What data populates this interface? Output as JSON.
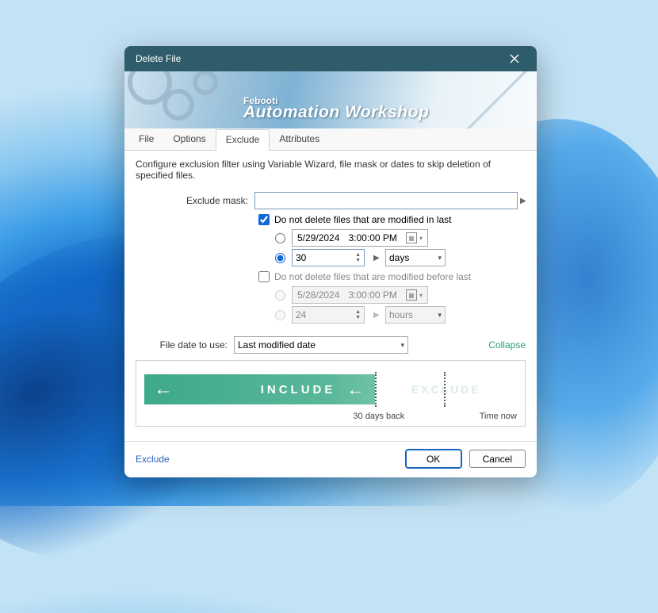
{
  "window": {
    "title": "Delete File"
  },
  "banner": {
    "small": "Febooti",
    "big": "Automation Workshop"
  },
  "tabs": [
    "File",
    "Options",
    "Exclude",
    "Attributes"
  ],
  "active_tab": 2,
  "description": "Configure exclusion filter using Variable Wizard, file mask or dates to skip deletion of specified files.",
  "exclude_mask": {
    "label": "Exclude mask:",
    "value": ""
  },
  "mod_in_last": {
    "checkbox_label": "Do not delete files that are modified in last",
    "checked": true,
    "date_option": {
      "selected": false,
      "date": "5/29/2024",
      "time": "3:00:00 PM"
    },
    "num_option": {
      "selected": true,
      "value": "30",
      "unit": "days"
    }
  },
  "mod_before_last": {
    "checkbox_label": "Do not delete files that are modified before last",
    "checked": false,
    "date_option": {
      "selected": false,
      "date": "5/28/2024",
      "time": "3:00:00 PM"
    },
    "num_option": {
      "selected": false,
      "value": "24",
      "unit": "hours"
    }
  },
  "file_date": {
    "label": "File date to use:",
    "value": "Last modified date"
  },
  "collapse_label": "Collapse",
  "timeline": {
    "include_label": "INCLUDE",
    "exclude_label": "EXCLUDE",
    "mark1": "30 days back",
    "mark2": "Time now"
  },
  "footer": {
    "status": "Exclude",
    "ok": "OK",
    "cancel": "Cancel"
  }
}
